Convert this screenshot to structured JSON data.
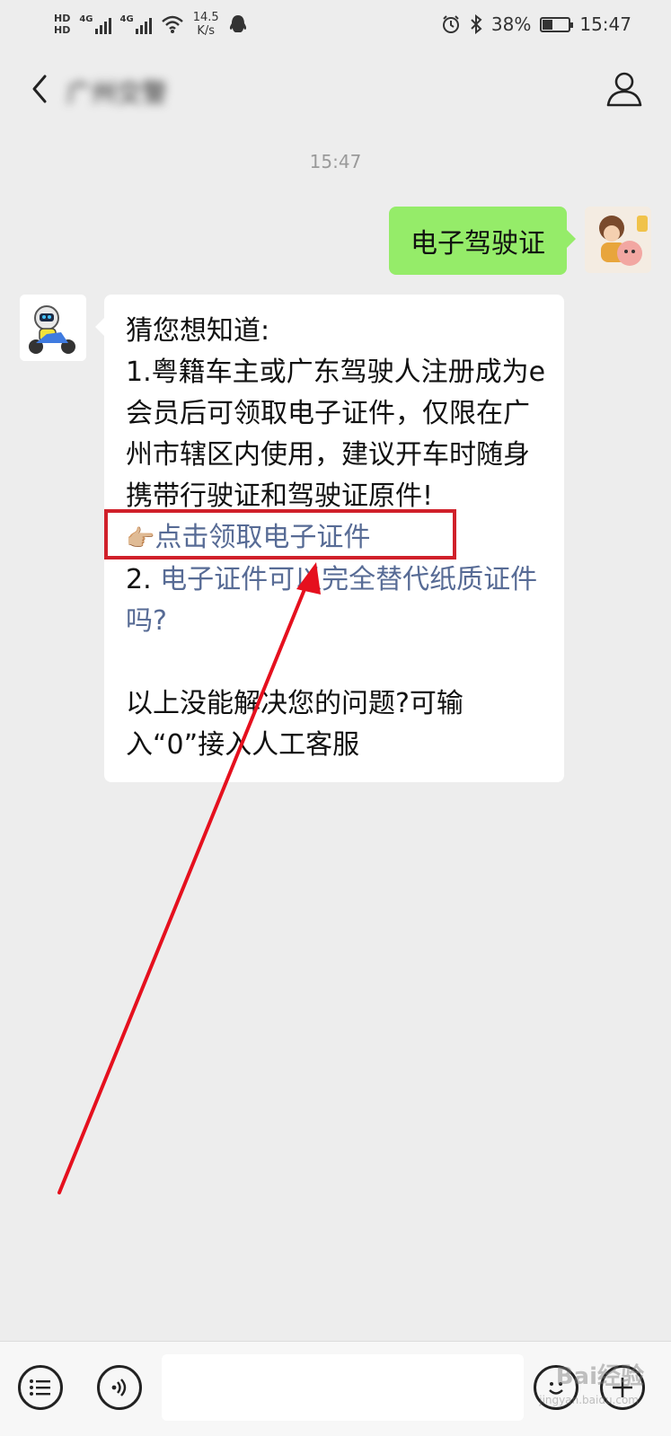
{
  "status_bar": {
    "hd1": "HD",
    "hd2": "HD",
    "net1": "4G",
    "net2": "4G",
    "speed_value": "14.5",
    "speed_unit": "K/s",
    "battery": "38%",
    "battery_level": 0.38,
    "time": "15:47"
  },
  "header": {
    "title": "广州交警"
  },
  "chat": {
    "timestamp": "15:47",
    "sent_message": "电子驾驶证",
    "reply": {
      "line1": "猜您想知道:",
      "item1": "1.粤籍车主或广东驾驶人注册成为e会员后可领取电子证件，仅限在广州市辖区内使用，建议开车时随身携带行驶证和驾驶证原件!",
      "link1": "点击领取电子证件",
      "item2_prefix": "2. ",
      "item2_link": "电子证件可以完全替代纸质证件吗?",
      "footer": "以上没能解决您的问题?可输入“0”接入人工客服"
    }
  },
  "bottom_bar": {
    "input_value": ""
  },
  "watermark": {
    "text": "Bai经验",
    "sub": "jingyan.baidu.com"
  }
}
